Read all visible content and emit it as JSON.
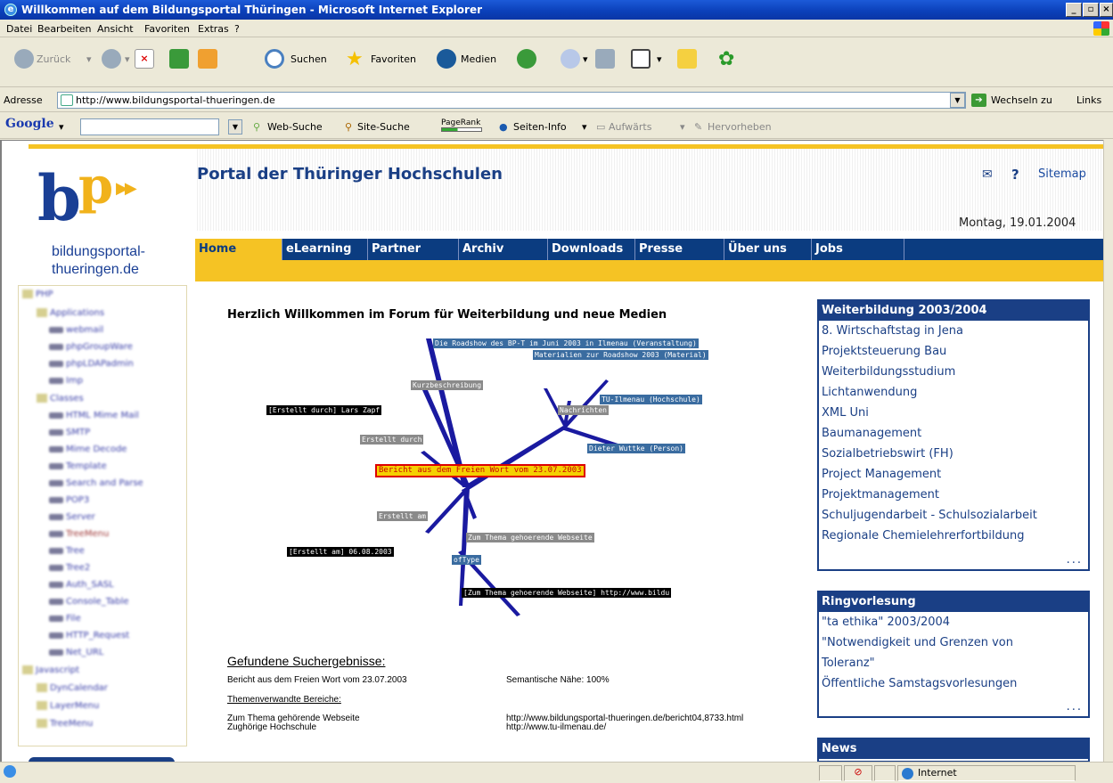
{
  "window": {
    "title": "Willkommen auf dem Bildungsportal Thüringen - Microsoft Internet Explorer",
    "min_btn": "_",
    "max_btn": "▫",
    "close_btn": "×"
  },
  "menu": [
    "Datei",
    "Bearbeiten",
    "Ansicht",
    "Favoriten",
    "Extras",
    "?"
  ],
  "toolbar": {
    "back": "Zurück",
    "search": "Suchen",
    "favorites": "Favoriten",
    "media": "Medien"
  },
  "address": {
    "label": "Adresse",
    "url": "http://www.bildungsportal-thueringen.de",
    "go": "Wechseln zu",
    "links": "Links"
  },
  "google": {
    "logo": "Google",
    "web_search": "Web-Suche",
    "site_search": "Site-Suche",
    "pagerank": "PageRank",
    "page_info": "Seiten-Info",
    "up": "Aufwärts",
    "highlight": "Hervorheben"
  },
  "site": {
    "logo_line1": "bildungsportal-",
    "logo_line2": "thueringen.de",
    "portal_title": "Portal der Thüringer Hochschulen",
    "sitemap": "Sitemap",
    "date": "Montag, 19.01.2004",
    "nav": [
      "Home",
      "eLearning",
      "Partner",
      "Archiv",
      "Downloads",
      "Presse",
      "Über uns",
      "Jobs"
    ]
  },
  "tree": [
    "PHP",
    "Applications",
    "webmail",
    "phpGroupWare",
    "phpLDAPadmin",
    "Imp",
    "Classes",
    "HTML Mime Mail",
    "SMTP",
    "Mime Decode",
    "Template",
    "Search and Parse",
    "POP3",
    "Server",
    "TreeMenu",
    "Tree",
    "Tree2",
    "Auth_SASL",
    "Console_Table",
    "File",
    "HTTP_Request",
    "Net_URL",
    "Javascript",
    "DynCalendar",
    "LayerMenu",
    "TreeMenu"
  ],
  "main": {
    "welcome": "Herzlich Willkommen im Forum für Weiterbildung und neue Medien",
    "graph": {
      "roadshow": "Die Roadshow des BP-T im Juni 2003 in Ilmenau (Veranstaltung)",
      "materialien": "Materialien zur Roadshow 2003 (Material)",
      "kurz": "Kurzbeschreibung",
      "tu": "TU-Ilmenau (Hochschule)",
      "nachrichten": "Nachrichten",
      "erstellt_durch_val": "[Erstellt durch] Lars Zapf",
      "erstellt_durch": "Erstellt durch",
      "wuttke": "Dieter Wuttke (Person)",
      "bericht": "Bericht aus dem Freien Wort vom 23.07.2003",
      "erstellt_am": "Erstellt am",
      "erstellt_am_val": "[Erstellt am] 06.08.2003",
      "thema": "Zum Thema gehoerende Webseite",
      "oftype": "ofType",
      "thema_val": "[Zum Thema gehoerende Webseite] http://www.bildu"
    },
    "results_title": "Gefundene Suchergebnisse:",
    "result1": "Bericht aus dem Freien Wort vom 23.07.2003",
    "result1_score": "Semantische Nähe: 100%",
    "related_title": "Themenverwandte Bereiche:",
    "rel1_label": "Zum Thema gehörende Webseite",
    "rel2_label": "Zughörige Hochschule",
    "rel1_url": "http://www.bildungsportal-thueringen.de/bericht04,8733.html",
    "rel2_url": "http://www.tu-ilmenau.de/"
  },
  "right": {
    "box1_title": "Weiterbildung 2003/2004",
    "box1_items": [
      "8. Wirtschaftstag in Jena",
      "Projektsteuerung Bau",
      "Weiterbildungsstudium",
      "Lichtanwendung",
      "XML Uni",
      "Baumanagement",
      "Sozialbetriebswirt (FH)",
      "Project Management",
      "Projektmanagement",
      "Schuljugendarbeit - Schulsozialarbeit",
      "Regionale Chemielehrerfortbildung"
    ],
    "more": "...",
    "box2_title": "Ringvorlesung",
    "box2_items": [
      "\"ta ethika\" 2003/2004",
      "\"Notwendigkeit und Grenzen von",
      "Toleranz\"",
      "Öffentliche Samstagsvorlesungen"
    ],
    "box3_title": "News"
  },
  "status": {
    "zone": "Internet"
  }
}
